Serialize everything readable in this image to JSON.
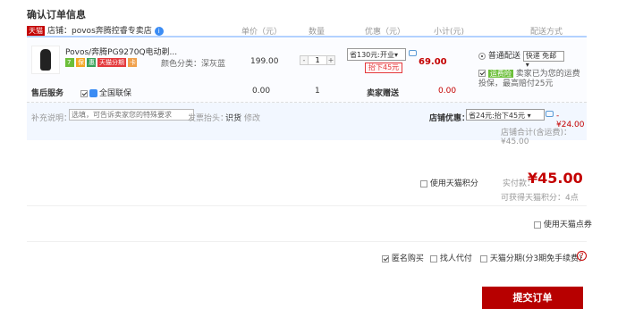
{
  "page_title": "确认订单信息",
  "header": {
    "tmall_logo": "天猫",
    "shop_label": "店铺：",
    "shop_name": "povos奔腾控睿专卖店",
    "col_price": "单价（元）",
    "col_qty": "数量",
    "col_discount": "优惠（元）",
    "col_subtotal": "小计(元)",
    "col_shipping": "配送方式"
  },
  "item": {
    "name": "Povos/奔腾PG9270Q电动剃...",
    "badges": [
      "7",
      "保",
      "惠",
      "天猫分期",
      "卡"
    ],
    "spec_label": "颜色分类：",
    "spec_value": "深灰蓝",
    "price": "199.00",
    "qty": "1",
    "qty_minus": "-",
    "qty_plus": "+",
    "promo_select": "省130元:开业",
    "promo_tag": "抬下45元",
    "subtotal": "69.00"
  },
  "shipping": {
    "option_label": "普通配送",
    "select_value": "快递 免邮",
    "insurance_tag": "运费险",
    "insurance_text": "卖家已为您的运费投保，最高赔付25元"
  },
  "after_sale": {
    "label": "售后服务",
    "service": "全国联保",
    "price": "0.00",
    "qty": "1",
    "gift": "卖家赠送",
    "subtotal": "0.00"
  },
  "remark": {
    "label": "补充说明：",
    "placeholder": "选填，可告诉卖家您的特殊要求",
    "invoice_label": "发票抬头：",
    "invoice_value": "识货",
    "invoice_edit": "修改",
    "shop_discount_label": "店铺优惠：",
    "shop_discount_select": "省24元:抬下45元",
    "shop_discount_amount": "-¥24.00",
    "shop_total": "店铺合计(含运费)：¥45.00"
  },
  "summary": {
    "use_points": "使用天猫积分",
    "actual_label": "实付款：",
    "actual_value": "¥45.00",
    "earn_points": "可获得天猫积分：4点",
    "use_coupon": "使用天猫点券"
  },
  "options": {
    "anonymous": "匿名购买",
    "proxy_pay": "找人代付",
    "installment": "天猫分期(分3期免手续费)",
    "help": "?"
  },
  "submit_label": "提交订单",
  "colors": {
    "accent_red": "#c40000",
    "submit_bg": "#b70000",
    "header_border": "#b2d1ff",
    "remark_bg": "#f2f7ff"
  }
}
